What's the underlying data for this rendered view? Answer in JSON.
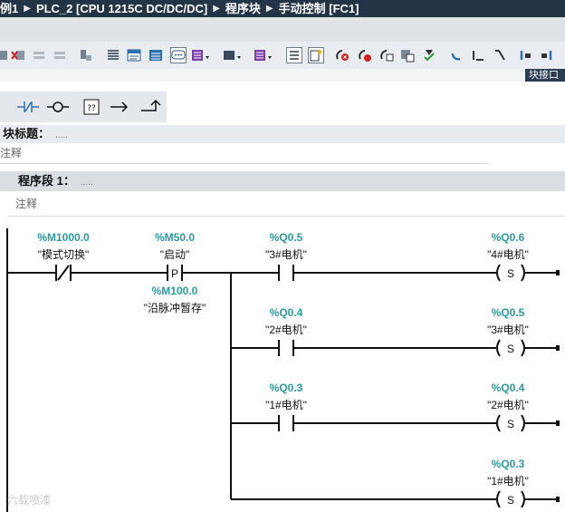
{
  "breadcrumb": {
    "items": [
      "例1",
      "PLC_2 [CPU 1215C DC/DC/DC]",
      "程序块",
      "手动控制 [FC1]"
    ]
  },
  "side_panel": {
    "label": "块接口"
  },
  "block": {
    "title_label": "块标题：",
    "title_value": ".....",
    "comment": "注释"
  },
  "network": {
    "title_label": "程序段 1：",
    "title_value": ".....",
    "comment": "注释"
  },
  "rungs": {
    "row1": {
      "contact_nc": {
        "address": "%M1000.0",
        "symbol": "\"模式切换\""
      },
      "contact_p": {
        "address": "%M50.0",
        "symbol": "\"启动\"",
        "edge_label": "P",
        "memory_address": "%M100.0",
        "memory_symbol": "\"沿脉冲暂存\""
      },
      "contact": {
        "address": "%Q0.5",
        "symbol": "\"3#电机\""
      },
      "coil": {
        "address": "%Q0.6",
        "symbol": "\"4#电机\"",
        "type": "S"
      }
    },
    "row2": {
      "contact": {
        "address": "%Q0.4",
        "symbol": "\"2#电机\""
      },
      "coil": {
        "address": "%Q0.5",
        "symbol": "\"3#电机\"",
        "type": "S"
      }
    },
    "row3": {
      "contact": {
        "address": "%Q0.3",
        "symbol": "\"1#电机\""
      },
      "coil": {
        "address": "%Q0.4",
        "symbol": "\"2#电机\"",
        "type": "S"
      }
    },
    "row4": {
      "coil": {
        "address": "%Q0.3",
        "symbol": "\"1#电机\"",
        "type": "S"
      }
    }
  },
  "colors": {
    "address": "#2a9c9e",
    "title_bar": "#243447",
    "toolbar": "#e9edf1"
  },
  "watermark": "六载喷漆"
}
